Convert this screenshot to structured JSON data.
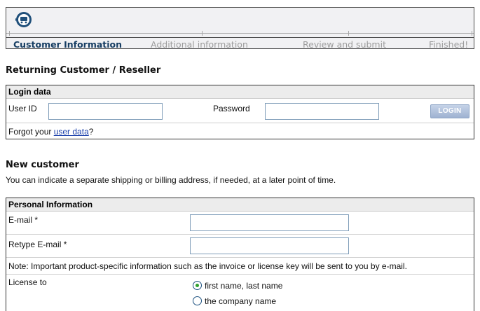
{
  "steps": [
    {
      "label": "Customer Information",
      "active": true
    },
    {
      "label": "Additional information",
      "active": false
    },
    {
      "label": "Review and submit",
      "active": false
    },
    {
      "label": "Finished!",
      "active": false
    }
  ],
  "returning": {
    "heading": "Returning Customer / Reseller",
    "box_title": "Login data",
    "user_id_label": "User ID",
    "user_id_value": "",
    "password_label": "Password",
    "password_value": "",
    "login_button": "LOGIN",
    "forgot_prefix": "Forgot your ",
    "forgot_link": "user data",
    "forgot_suffix": "?"
  },
  "new_customer": {
    "heading": "New customer",
    "description": "You can indicate a separate shipping or billing address, if needed, at a later point of time.",
    "box_title": "Personal Information",
    "email_label": "E-mail *",
    "email_value": "",
    "retype_email_label": "Retype E-mail *",
    "retype_email_value": "",
    "note": "Note: Important product-specific information such as the invoice or license key will be sent to you by e-mail.",
    "license_label": "License to",
    "license_options": [
      {
        "label": "first name, last name",
        "selected": true
      },
      {
        "label": "the company name",
        "selected": false
      }
    ]
  },
  "icons": {
    "cart": "shopping-cart-icon"
  },
  "colors": {
    "active_step": "#173e63",
    "inactive_step": "#9c9c9c",
    "link": "#1a3faa",
    "radio_selected": "#2fa12f"
  }
}
